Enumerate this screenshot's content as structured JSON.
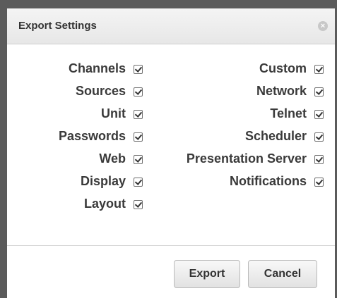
{
  "dialog": {
    "title": "Export Settings",
    "close_glyph": "⊗"
  },
  "options": {
    "left": [
      {
        "label": "Channels",
        "checked": true
      },
      {
        "label": "Sources",
        "checked": true
      },
      {
        "label": "Unit",
        "checked": true
      },
      {
        "label": "Passwords",
        "checked": true
      },
      {
        "label": "Web",
        "checked": true
      },
      {
        "label": "Display",
        "checked": true
      },
      {
        "label": "Layout",
        "checked": true
      }
    ],
    "right": [
      {
        "label": "Custom",
        "checked": true
      },
      {
        "label": "Network",
        "checked": true
      },
      {
        "label": "Telnet",
        "checked": true
      },
      {
        "label": "Scheduler",
        "checked": true
      },
      {
        "label": "Presentation Server",
        "checked": true
      },
      {
        "label": "Notifications",
        "checked": true
      }
    ]
  },
  "buttons": {
    "export_label": "Export",
    "cancel_label": "Cancel"
  }
}
